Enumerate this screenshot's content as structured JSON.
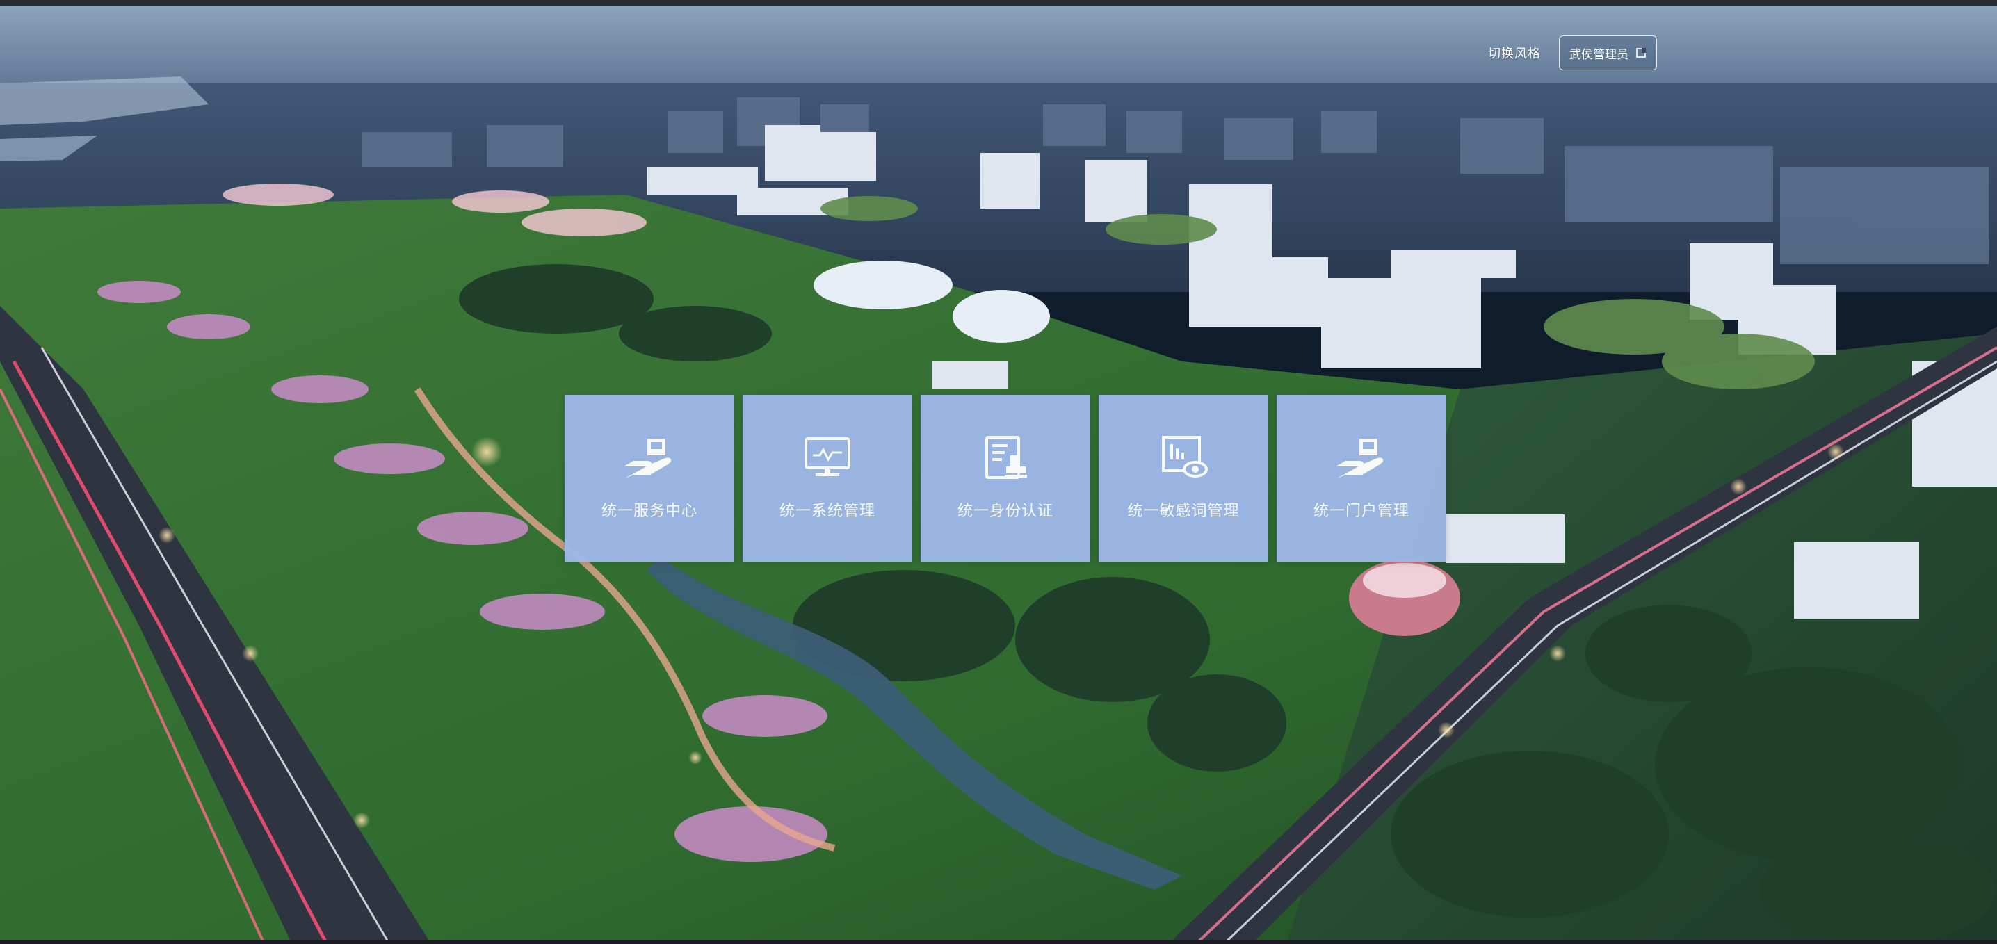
{
  "header": {
    "switch_style_label": "切换风格",
    "user_label": "武侯管理员"
  },
  "cards": [
    {
      "label": "统一服务中心",
      "icon": "hand-service-icon"
    },
    {
      "label": "统一系统管理",
      "icon": "monitor-icon"
    },
    {
      "label": "统一身份认证",
      "icon": "id-document-icon"
    },
    {
      "label": "统一敏感词管理",
      "icon": "monitor-eye-icon"
    },
    {
      "label": "统一门户管理",
      "icon": "hand-portal-icon"
    }
  ],
  "colors": {
    "card_bg": "#9db7e6",
    "card_text": "#ffffff"
  }
}
